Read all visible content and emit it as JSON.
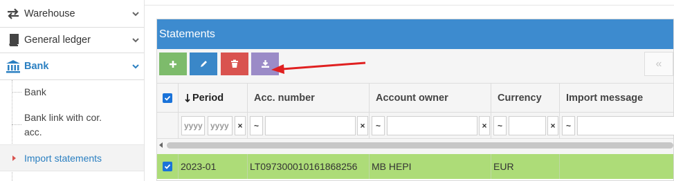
{
  "sidebar": {
    "items": [
      {
        "label": "Warehouse",
        "icon": "transfer-icon"
      },
      {
        "label": "General ledger",
        "icon": "book-icon"
      },
      {
        "label": "Bank",
        "icon": "bank-icon"
      }
    ],
    "sub_items": [
      {
        "label": "Bank"
      },
      {
        "label": "Bank link with cor. acc."
      },
      {
        "label": "Import statements"
      }
    ]
  },
  "panel": {
    "title": "Statements"
  },
  "toolbar": {
    "add_icon": "plus-icon",
    "edit_icon": "pencil-icon",
    "delete_icon": "trash-icon",
    "import_icon": "download-icon",
    "pager_prev": "«"
  },
  "table": {
    "columns": [
      {
        "label": "Period",
        "sort_icon": "sort-desc-icon"
      },
      {
        "label": "Acc. number"
      },
      {
        "label": "Account owner"
      },
      {
        "label": "Currency"
      },
      {
        "label": "Import message"
      }
    ],
    "filters": {
      "period_from_placeholder": "yyyy",
      "period_to_placeholder": "yyyy",
      "clear": "×",
      "op": "~"
    },
    "rows": [
      {
        "period": "2023-01",
        "acc_number": "LT097300010161868256",
        "account_owner": "MB HEPI",
        "currency": "EUR",
        "import_message": ""
      }
    ]
  },
  "colors": {
    "header_blue": "#3d8bcf",
    "add_green": "#7dbb6b",
    "edit_blue": "#3a87c8",
    "delete_red": "#d9534f",
    "import_purple": "#9b8bc7",
    "row_green": "#addc78",
    "annotation_red": "#e02020",
    "active_link": "#2a7fc1"
  }
}
